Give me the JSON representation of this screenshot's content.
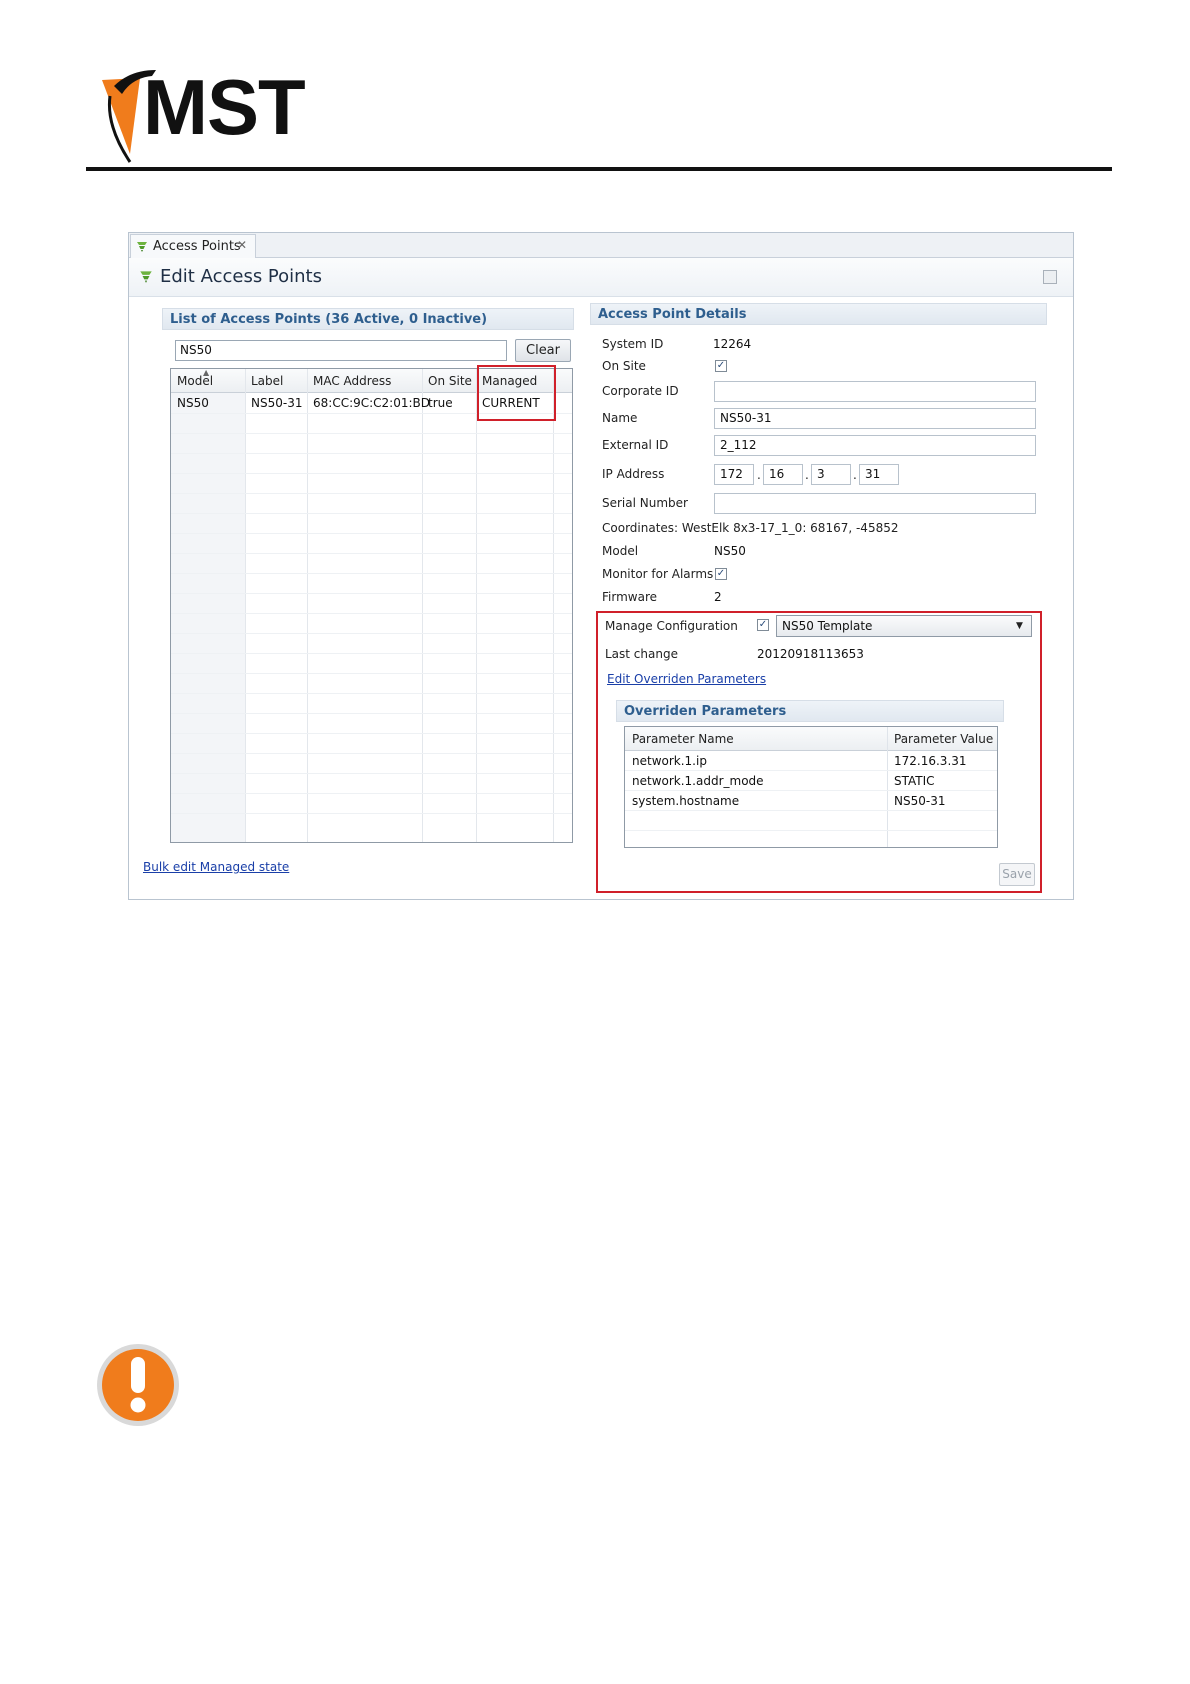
{
  "brand": {
    "logo_text": "MST",
    "accent": "#f07c1c"
  },
  "tab": {
    "label": "Access Points"
  },
  "editor": {
    "title": "Edit Access Points"
  },
  "list": {
    "section_title": "List of Access Points (36 Active, 0 Inactive)",
    "search_value": "NS50",
    "clear_label": "Clear",
    "columns": [
      "Model",
      "Label",
      "MAC Address",
      "On Site",
      "Managed"
    ],
    "rows": [
      [
        "NS50",
        "NS50-31",
        "68:CC:9C:C2:01:BD",
        "true",
        "CURRENT"
      ]
    ],
    "bulk_link": "Bulk edit Managed state"
  },
  "details": {
    "section_title": "Access Point Details",
    "system_id_label": "System ID",
    "system_id": "12264",
    "on_site_label": "On Site",
    "corporate_id_label": "Corporate ID",
    "corporate_id": "",
    "name_label": "Name",
    "name": "NS50-31",
    "external_id_label": "External ID",
    "external_id": "2_112",
    "ip_label": "IP Address",
    "ip": [
      "172",
      "16",
      "3",
      "31"
    ],
    "serial_label": "Serial Number",
    "serial": "",
    "coordinates_text": "Coordinates: WestElk 8x3-17_1_0: 68167, -45852",
    "model_label": "Model",
    "model": "NS50",
    "monitor_label": "Monitor for Alarms",
    "firmware_label": "Firmware",
    "firmware": "2"
  },
  "manage": {
    "label": "Manage Configuration",
    "template": "NS50 Template",
    "last_change_label": "Last change",
    "last_change": "20120918113653",
    "edit_link": "Edit Overriden Parameters",
    "overrides_title": "Overriden Parameters",
    "columns": [
      "Parameter Name",
      "Parameter Value"
    ],
    "rows": [
      [
        "network.1.ip",
        "172.16.3.31"
      ],
      [
        "network.1.addr_mode",
        "STATIC"
      ],
      [
        "system.hostname",
        "NS50-31"
      ]
    ],
    "save_label": "Save"
  },
  "icons": {
    "tab": "antenna-icon",
    "header": "antenna-icon",
    "save": "disk-icon",
    "warning": "exclamation-icon"
  }
}
